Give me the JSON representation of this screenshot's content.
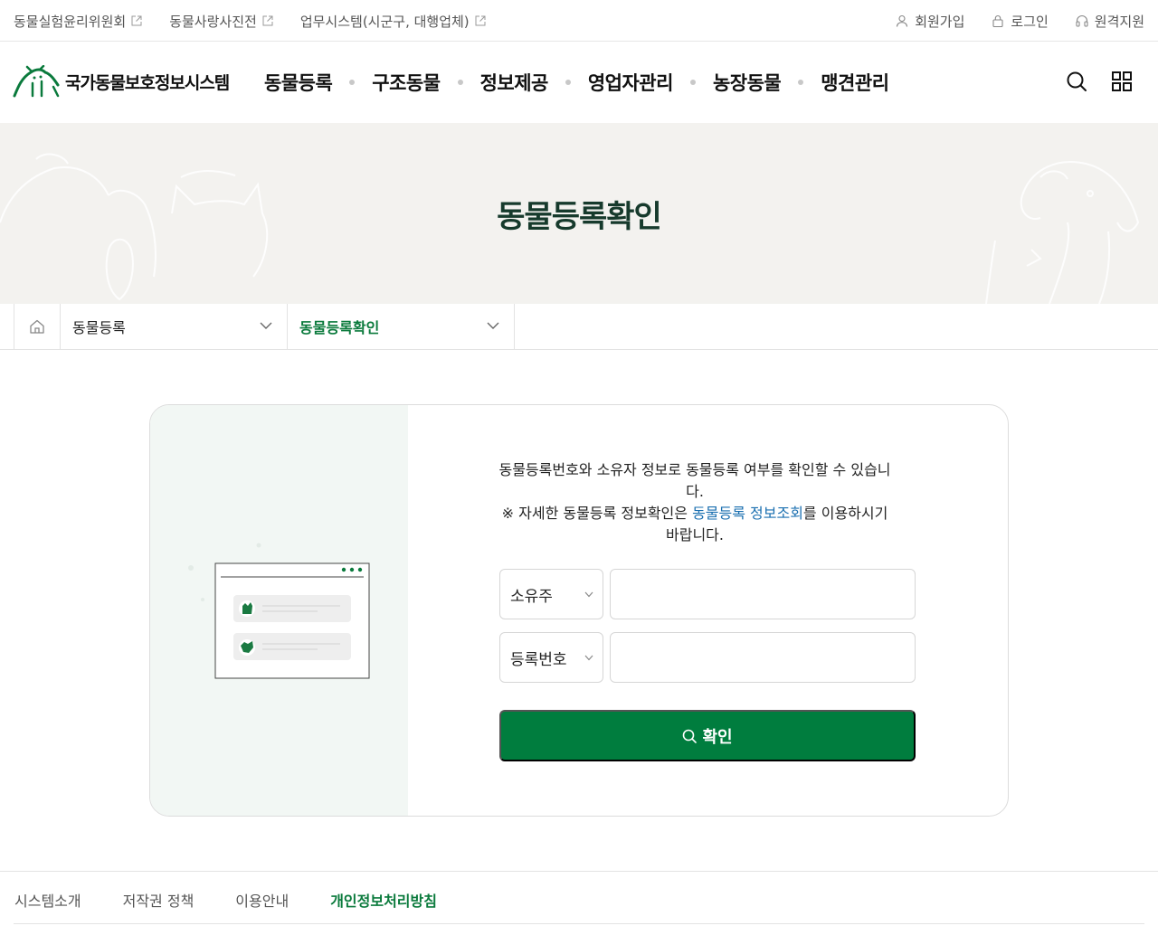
{
  "util_left": [
    {
      "label": "동물실험윤리위원회",
      "icon": "external-link-icon"
    },
    {
      "label": "동물사랑사진전",
      "icon": "external-link-icon"
    },
    {
      "label": "업무시스템(시군구, 대행업체)",
      "icon": "external-link-icon"
    }
  ],
  "util_right": [
    {
      "label": "회원가입",
      "icon": "user-icon"
    },
    {
      "label": "로그인",
      "icon": "lock-icon"
    },
    {
      "label": "원격지원",
      "icon": "headset-icon"
    }
  ],
  "logo": {
    "text": "국가동물보호정보시스템",
    "icon": "dog-cat-logo-icon"
  },
  "gnb": [
    "동물등록",
    "구조동물",
    "정보제공",
    "영업자관리",
    "농장동물",
    "맹견관리"
  ],
  "header_icons": [
    "search-icon",
    "all-menu-grid-icon"
  ],
  "page_title": "동물등록확인",
  "breadcrumb": {
    "home_icon": "home-icon",
    "level1": "동물등록",
    "level2": "동물등록확인"
  },
  "form": {
    "desc_line1": "동물등록번호와 소유자 정보로 동물등록 여부를 확인할 수 있습니다.",
    "desc_line2_pre": "※ 자세한 동물등록 정보확인은 ",
    "desc_line2_link": "동물등록 정보조회",
    "desc_line2_post": "를 이용하시기 바랍니다.",
    "select1": "소유주",
    "select2": "등록번호",
    "input1_value": "",
    "input2_value": "",
    "button_label": "확인"
  },
  "footer": [
    "시스템소개",
    "저작권 정책",
    "이용안내",
    "개인정보처리방침"
  ],
  "colors": {
    "brand_green": "#007d3e",
    "title_green": "#163a2c",
    "link_blue": "#1a6fb0"
  }
}
